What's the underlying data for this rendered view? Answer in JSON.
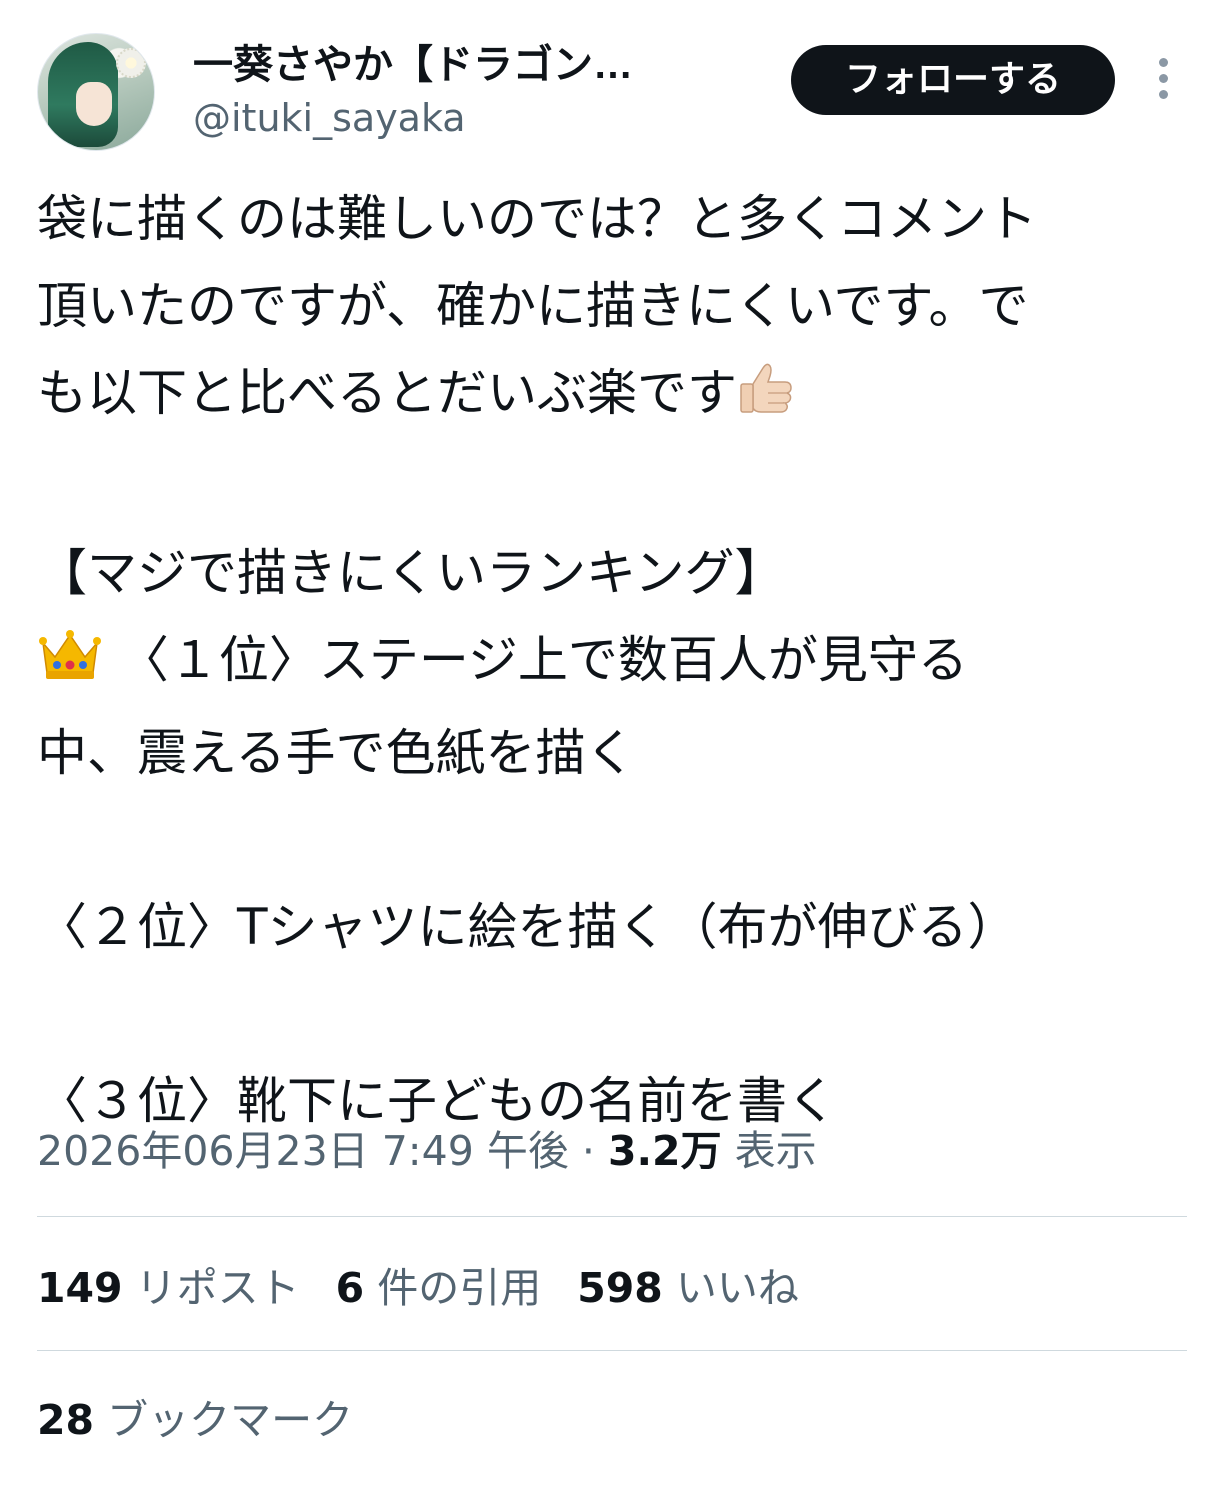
{
  "author": {
    "display_name": "一葵さやか【ドラゴン…",
    "handle": "@ituki_sayaka"
  },
  "follow_label": "フォローする",
  "tweet_lines": [
    "袋に描くのは難しいのでは？と多くコメント",
    "頂いたのですが、確かに描きにくいです。で",
    "も以下と比べるとだいぶ楽です",
    "",
    "【マジで描きにくいランキング】",
    "〈１位〉ステージ上で数百人が見守る",
    "中、震える手で色紙を描く",
    "",
    "〈２位〉Tシャツに絵を描く（布が伸びる）",
    "",
    "〈３位〉靴下に子どもの名前を書く"
  ],
  "meta": {
    "timestamp": "2026年06月23日 7:49 午後",
    "separator": " · ",
    "views_count": "3.2万",
    "views_label": "表示"
  },
  "stats": {
    "reposts_count": "149",
    "reposts_label": "リポスト",
    "quotes_count": "6",
    "quotes_label": "件の引用",
    "likes_count": "598",
    "likes_label": "いいね",
    "bookmarks_count": "28",
    "bookmarks_label": "ブックマーク"
  },
  "icons": [
    "thumbs-up-emoji",
    "crown-emoji",
    "more-options-icon"
  ]
}
